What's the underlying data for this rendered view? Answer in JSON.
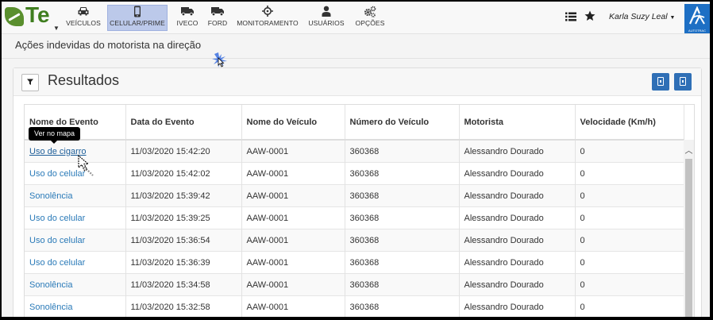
{
  "app": {
    "logo_text": "Te"
  },
  "nav": {
    "items": [
      {
        "label": "VEÍCULOS",
        "icon": "car-icon"
      },
      {
        "label": "CELULAR/PRIME",
        "icon": "phone-icon"
      },
      {
        "label": "IVECO",
        "icon": "truck-icon"
      },
      {
        "label": "FORD",
        "icon": "truck-icon"
      },
      {
        "label": "MONITORAMENTO",
        "icon": "crosshair-icon"
      },
      {
        "label": "USUÁRIOS",
        "icon": "user-icon"
      },
      {
        "label": "OPÇÕES",
        "icon": "gears-icon"
      }
    ],
    "active": "CELULAR/PRIME"
  },
  "user": {
    "name": "Karla Suzy Leal"
  },
  "brand": {
    "text": "AUTOTRAC",
    "color": "#1d6fc4"
  },
  "page": {
    "title": "Ações indevidas do motorista na direção"
  },
  "panel": {
    "title": "Resultados"
  },
  "table": {
    "headers": [
      "Nome do Evento",
      "Data do Evento",
      "Nome do Veículo",
      "Número do Veículo",
      "Motorista",
      "Velocidade (Km/h)"
    ],
    "rows": [
      [
        "Uso de cigarro",
        "11/03/2020 15:42:20",
        "AAW-0001",
        "360368",
        "Alessandro Dourado",
        "0"
      ],
      [
        "Uso do celular",
        "11/03/2020 15:42:02",
        "AAW-0001",
        "360368",
        "Alessandro Dourado",
        "0"
      ],
      [
        "Sonolência",
        "11/03/2020 15:39:42",
        "AAW-0001",
        "360368",
        "Alessandro Dourado",
        "0"
      ],
      [
        "Uso do celular",
        "11/03/2020 15:39:25",
        "AAW-0001",
        "360368",
        "Alessandro Dourado",
        "0"
      ],
      [
        "Uso do celular",
        "11/03/2020 15:36:54",
        "AAW-0001",
        "360368",
        "Alessandro Dourado",
        "0"
      ],
      [
        "Uso do celular",
        "11/03/2020 15:36:39",
        "AAW-0001",
        "360368",
        "Alessandro Dourado",
        "0"
      ],
      [
        "Sonolência",
        "11/03/2020 15:34:58",
        "AAW-0001",
        "360368",
        "Alessandro Dourado",
        "0"
      ],
      [
        "Sonolência",
        "11/03/2020 15:32:58",
        "AAW-0001",
        "360368",
        "Alessandro Dourado",
        "0"
      ]
    ]
  },
  "tooltip": {
    "text": "Ver no mapa"
  },
  "colors": {
    "accent": "#2f6fb6",
    "link": "#2a7ab8",
    "nav_active": "#bcc9ea"
  }
}
